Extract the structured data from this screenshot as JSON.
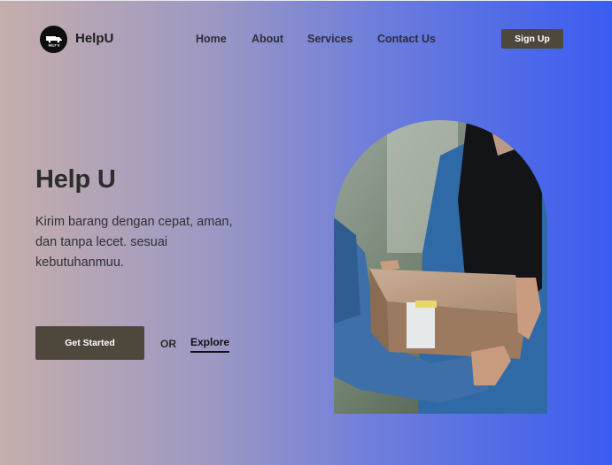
{
  "header": {
    "logo_icon": "truck-logo-icon",
    "logo_text": "HELP U",
    "brand": "HelpU",
    "nav": {
      "home": "Home",
      "about": "About",
      "services": "Services",
      "contact": "Contact Us"
    },
    "signup_label": "Sign Up"
  },
  "hero": {
    "title": "Help U",
    "description": "Kirim barang dengan cepat, aman, dan tanpa lecet. sesuai kebutuhanmuu.",
    "get_started_label": "Get Started",
    "or_label": "OR",
    "explore_label": "Explore"
  },
  "colors": {
    "button_bg": "#4d473c",
    "gradient_start": "#c5aeab",
    "gradient_end": "#3b5cf0"
  }
}
